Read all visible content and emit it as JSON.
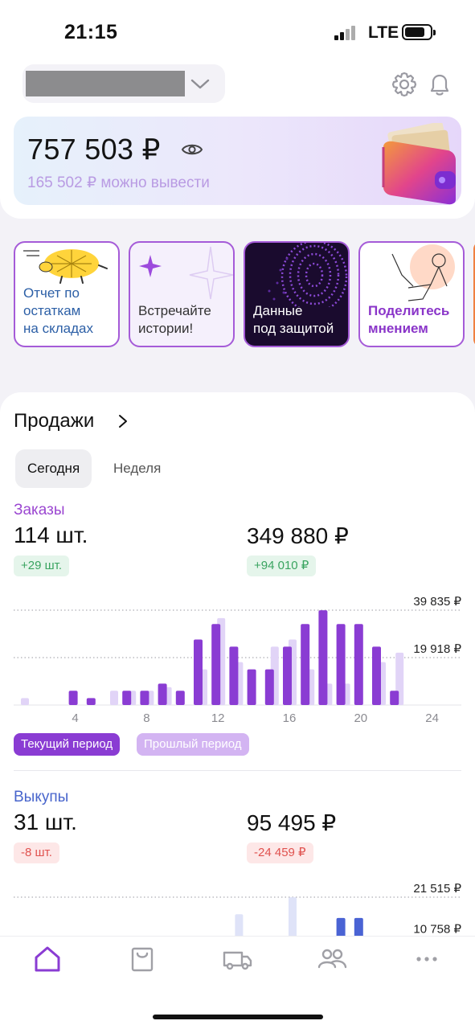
{
  "status_bar": {
    "time": "21:15",
    "network": "LTE"
  },
  "header": {
    "account_selector_icon": "chevron-down-icon",
    "settings_icon": "gear-icon",
    "notifications_icon": "bell-icon"
  },
  "balance": {
    "amount": "757 503 ₽",
    "withdrawable": "165 502 ₽ можно вывести",
    "visibility_icon": "eye-icon"
  },
  "stories": [
    {
      "label_line1": "Отчет по",
      "label_line2": "остаткам",
      "label_line3": "на складах"
    },
    {
      "label_line1": "Встречайте",
      "label_line2": "истории!"
    },
    {
      "label_line1": "Данные",
      "label_line2": "под защитой"
    },
    {
      "label_line1": "Поделитесь",
      "label_line2": "мнением"
    }
  ],
  "sales": {
    "title": "Продажи",
    "tabs": [
      {
        "label": "Сегодня",
        "active": true
      },
      {
        "label": "Неделя",
        "active": false
      }
    ],
    "orders": {
      "label": "Заказы",
      "count": "114 шт.",
      "sum": "349 880 ₽",
      "count_delta": "+29 шт.",
      "sum_delta": "+94 010 ₽"
    },
    "buyouts": {
      "label": "Выкупы",
      "count": "31 шт.",
      "sum": "95 495 ₽",
      "count_delta": "-8 шт.",
      "sum_delta": "-24 459 ₽"
    },
    "legend": {
      "current": "Текущий период",
      "previous": "Прошлый период"
    }
  },
  "chart_data": [
    {
      "type": "bar",
      "ylim": [
        0,
        39835
      ],
      "y_tick_labels": [
        "39 835 ₽",
        "19 918 ₽"
      ],
      "y_ticks": [
        39835,
        19918
      ],
      "x_tick_labels": [
        "4",
        "8",
        "12",
        "16",
        "20",
        "24"
      ],
      "x_ticks": [
        4,
        8,
        12,
        16,
        20,
        24
      ],
      "categories": [
        1,
        2,
        3,
        4,
        5,
        6,
        7,
        8,
        9,
        10,
        11,
        12,
        13,
        14,
        15,
        16,
        17,
        18,
        19,
        20,
        21,
        22,
        23
      ],
      "series": [
        {
          "name": "Текущий период",
          "color": "#8a3cd3",
          "values": [
            0,
            0,
            0,
            6000,
            2900,
            0,
            6000,
            6000,
            9000,
            6000,
            27500,
            34000,
            24500,
            15000,
            15000,
            24500,
            34000,
            39800,
            34000,
            34000,
            24500,
            6000,
            0
          ]
        },
        {
          "name": "Прошлый период",
          "color": "#e1d4f7",
          "values": [
            2900,
            0,
            0,
            0,
            0,
            6000,
            6000,
            6000,
            7500,
            0,
            15000,
            36500,
            18000,
            0,
            24500,
            27500,
            15000,
            9000,
            9000,
            0,
            18000,
            22000,
            0
          ]
        }
      ]
    },
    {
      "type": "bar",
      "ylim": [
        0,
        21515
      ],
      "y_tick_labels": [
        "21 515 ₽",
        "10 758 ₽"
      ],
      "y_ticks": [
        21515,
        10758
      ],
      "categories": [
        1,
        2,
        3,
        4,
        5,
        6,
        7,
        8,
        9,
        10,
        11,
        12,
        13,
        14,
        15,
        16,
        17,
        18,
        19,
        20,
        21,
        22,
        23
      ],
      "series": [
        {
          "name": "Текущий период",
          "color": "#4a63d4",
          "values": [
            0,
            0,
            0,
            0,
            0,
            0,
            0,
            0,
            0,
            0,
            0,
            9000,
            0,
            0,
            0,
            0,
            0,
            3500,
            16000,
            16000,
            0,
            0,
            0
          ]
        },
        {
          "name": "Прошлый период",
          "color": "#dfe3f8",
          "values": [
            0,
            0,
            0,
            0,
            0,
            0,
            0,
            0,
            0,
            0,
            3500,
            0,
            17000,
            0,
            0,
            21500,
            0,
            0,
            9000,
            0,
            5500,
            0,
            0
          ]
        }
      ]
    }
  ],
  "tab_bar": [
    {
      "icon": "home-icon",
      "active": true
    },
    {
      "icon": "shopping-bag-icon",
      "active": false
    },
    {
      "icon": "truck-icon",
      "active": false
    },
    {
      "icon": "users-icon",
      "active": false
    },
    {
      "icon": "more-icon",
      "active": false
    }
  ]
}
